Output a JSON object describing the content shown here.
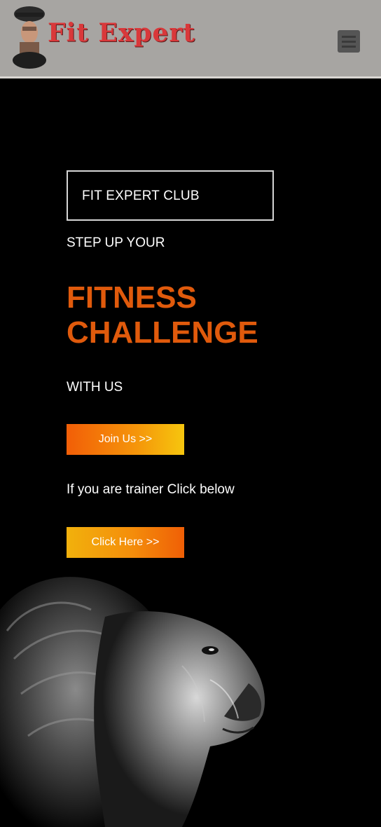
{
  "header": {
    "logo_text": "Fit Expert",
    "logo_icon": "fit-expert-logo-figure",
    "menu_icon": "hamburger-menu-icon",
    "background": "#a7a5a2"
  },
  "hero": {
    "club_label": "FIT EXPERT CLUB",
    "step_up": "STEP UP YOUR",
    "headline_line1": "FITNESS",
    "headline_line2": "CHALLENGE",
    "with_us": "WITH US",
    "join_button": "Join Us >>",
    "trainer_text": "If you are trainer Click below",
    "click_button": "Click Here >>",
    "image": "lion-image",
    "accent_color": "#e05a0c"
  }
}
